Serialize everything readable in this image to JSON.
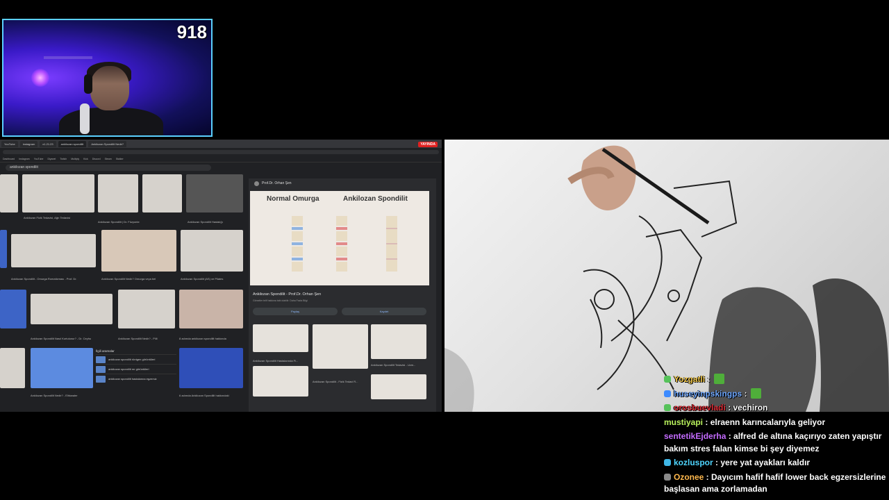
{
  "webcam": {
    "counter": "918"
  },
  "browser": {
    "tabs": [
      "YouTube",
      "instagram",
      "x1.21.23",
      "ankilozan spondilit",
      "Ankilozan Spondilit Nedir?"
    ],
    "live_badge": "YAYINDA",
    "search_query": "ankilozan spondilit",
    "bookmarks": [
      "Dashboard",
      "Instagram",
      "YouTube",
      "Diyanet",
      "Twitch",
      "Multiply",
      "Kick",
      "Discord",
      "Steam",
      "Stalker"
    ],
    "captions": [
      "Ankilozan Fizik Tedavisi, Ağrı Tedavisi",
      "Ankilozan Spondilit | Dr. Füzyonterapist",
      "Ankilozan Spondilit Hastalığı",
      "Ankilozan Spondilit - Omurga Romatizması - Prof. Dr.",
      "Ankilozan Spondilit Nedir? Omurga veya bel",
      "Ankilozan Spondilit (AS) ve Pilates",
      "Ankilozan Spondilit Nasıl Kurtulunur? - Dr. Ceyhu",
      "Ankilozan Spondilit Nedir? - Pilli",
      "8 adımda ankilozan spondilit hakkında",
      "Ankilozan Spondilit Nedir? - Elhkwaler",
      "6 adımda Ankilozan Spondilit hakkındaki"
    ],
    "related": {
      "title": "İlgili aramalar",
      "items": [
        "ankilozan spondilit röntgen görüntüleri",
        "ankilozan spondilit mr görüntüleri",
        "ankilozan spondilit hastalarına egzersiz"
      ]
    },
    "panel": {
      "source": "Prof.Dr. Orhan Şen",
      "diagram_left_title": "Normal Omurga",
      "diagram_right_title": "Ankilozan Spondilit",
      "title": "Ankilozan Spondilit - Prof.Dr. Orhan Şen",
      "subtitle": "Görseller telif hakkına tabi olabilir. Daha Fazla Bilgi",
      "share_label": "Paylaş",
      "save_label": "Kaydet",
      "more_captions": [
        "Ankilozan Spondilit Hastalarında Fi...",
        "Ankilozan Spondilit - Fizik Tedavi R...",
        "Ankilozan Spondilit Tedavisi - Uzm..."
      ]
    }
  },
  "chat": [
    {
      "user": "Yozgatli",
      "color": "#f2c94c",
      "badge_color": "#56c25a",
      "text": "",
      "emote": true
    },
    {
      "user": "huseyinpskingps",
      "color": "#6fa8ff",
      "badge_color": "#3d8bff",
      "text": "",
      "emote": true
    },
    {
      "user": "orosbuevladi",
      "color": "#e0303a",
      "badge_color": "#56c25a",
      "text": "vechiron",
      "emote": false
    },
    {
      "user": "mustiyapi",
      "color": "#b8f05c",
      "badge_color": "",
      "text": "elraenn karıncalarıyla geliyor",
      "emote": false
    },
    {
      "user": "sentetikEjderha",
      "color": "#c46bff",
      "badge_color": "",
      "text": "alfred de altına kaçırıyo zaten yapıştır bakım stres falan kimse bi şey diyemez",
      "emote": false
    },
    {
      "user": "kozluspor",
      "color": "#4fd6ff",
      "badge_color": "#3fb6e6",
      "text": "yere yat ayakları kaldır",
      "emote": false
    },
    {
      "user": "Ozonee",
      "color": "#ffb84d",
      "badge_color": "#8a8a8a",
      "text": "Dayıcım hafif hafif lower back egzersizlerine başlasan ama zorlamadan",
      "emote": false
    }
  ]
}
